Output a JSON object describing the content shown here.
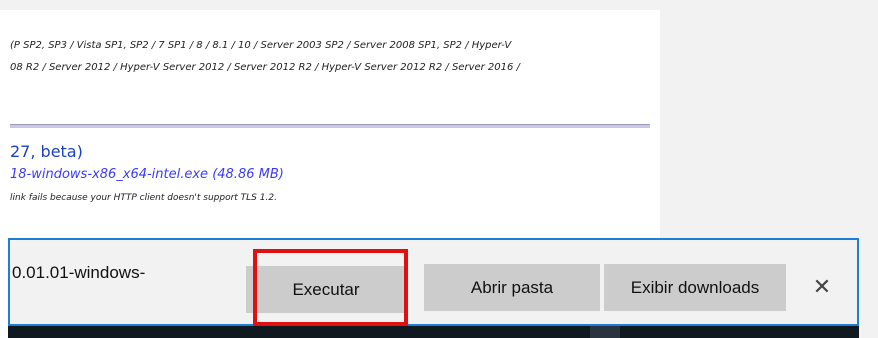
{
  "page": {
    "os_line1": "(P SP2, SP3 / Vista SP1, SP2 / 7 SP1 / 8 / 8.1 / 10 / Server 2003 SP2 / Server 2008 SP1, SP2 / Hyper-V",
    "os_line2": "08 R2 / Server 2012 / Hyper-V Server 2012 / Server 2012 R2 / Hyper-V Server 2012 R2 / Server 2016 /",
    "version_text": "27, beta)",
    "download_link": "18-windows-x86_x64-intel.exe (48.86 MB)",
    "tls_note": "link fails because your HTTP client doesn't support TLS 1.2."
  },
  "download_bar": {
    "filename": "0.01.01-windows-",
    "run_label": "Executar",
    "open_folder_label": "Abrir pasta",
    "show_downloads_label": "Exibir downloads",
    "close_icon": "close-icon",
    "close_glyph": "✕"
  },
  "colors": {
    "accent": "#1c7ed6",
    "highlight": "#e01010",
    "link": "#3a3aff"
  }
}
